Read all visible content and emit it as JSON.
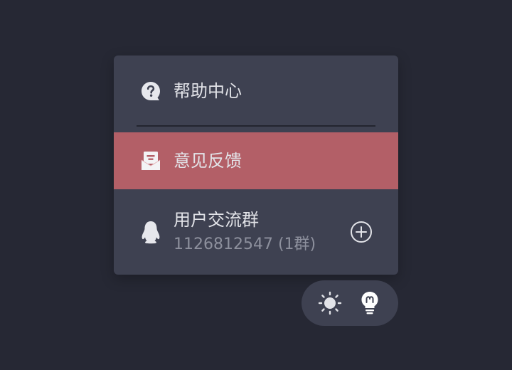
{
  "menu": {
    "help_center": {
      "label": "帮助中心",
      "icon": "question-bubble-icon"
    },
    "feedback": {
      "label": "意见反馈",
      "icon": "mail-icon"
    },
    "user_group": {
      "label": "用户交流群",
      "group_number": "1126812547 (1群)",
      "icon": "qq-penguin-icon",
      "action_icon": "plus-circle-icon"
    }
  },
  "toolbar": {
    "items": [
      {
        "icon": "sun-icon"
      },
      {
        "icon": "lightbulb-icon"
      }
    ]
  },
  "colors": {
    "background": "#262834",
    "panel": "#3e4151",
    "highlight": "#b35f67",
    "text": "#e2e3e8",
    "muted_text": "#8d909d"
  }
}
